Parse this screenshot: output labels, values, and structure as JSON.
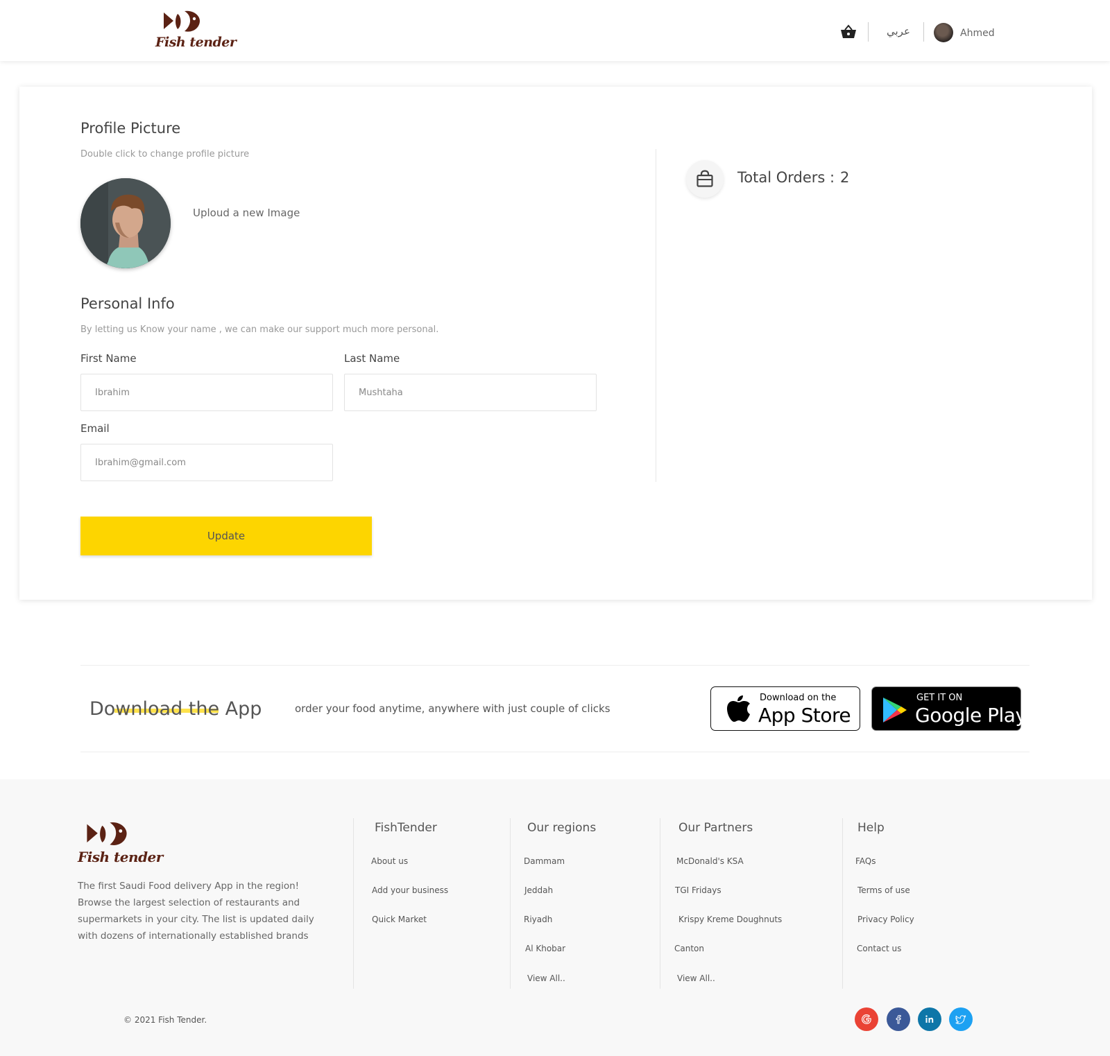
{
  "header": {
    "logo_text": "Fish tender",
    "lang_link": "عربي",
    "user_name": "Ahmed"
  },
  "profile": {
    "title": "Profile Picture",
    "subtitle": "Double click to change profile picture",
    "upload_link": "Uploud a new Image"
  },
  "personal_info": {
    "title": "Personal Info",
    "subtitle": "By letting us Know your name , we can make our support much more personal.",
    "first_name_label": "First Name",
    "first_name_value": "Ibrahim",
    "last_name_label": "Last Name",
    "last_name_value": "Mushtaha",
    "email_label": "Email",
    "email_value": "Ibrahim@gmail.com",
    "update_button": "Update"
  },
  "orders": {
    "label": "Total Orders :",
    "count": "2"
  },
  "download": {
    "title": "Download the App",
    "text": "order your food anytime, anywhere with just couple of clicks",
    "appstore_small": "Download on the",
    "appstore_big": "App Store",
    "gplay_small": "GET IT ON",
    "gplay_big": "Google Play"
  },
  "footer": {
    "logo_text": "Fish tender",
    "description": "The first Saudi Food delivery App in the region! Browse the largest selection of restaurants and supermarkets in your city. The list is updated daily with dozens of internationally established brands",
    "columns": [
      {
        "title": "FishTender",
        "links": [
          "About us",
          "Add your business",
          "Quick Market"
        ]
      },
      {
        "title": "Our regions",
        "links": [
          "Dammam",
          "Jeddah",
          "Riyadh",
          "Al Khobar",
          "View All.."
        ]
      },
      {
        "title": "Our Partners",
        "links": [
          "McDonald's KSA",
          "TGI Fridays",
          "Krispy Kreme Doughnuts",
          "Canton",
          "View All.."
        ]
      },
      {
        "title": "Help",
        "links": [
          "FAQs",
          "Terms of use",
          "Privacy Policy",
          "Contact us"
        ]
      }
    ],
    "copyright": "© 2021 Fish Tender.",
    "social": [
      {
        "name": "google",
        "color": "#ea4335"
      },
      {
        "name": "facebook",
        "color": "#3b5998"
      },
      {
        "name": "linkedin",
        "color": "#0e76a8"
      },
      {
        "name": "twitter",
        "color": "#1da1f2"
      }
    ]
  },
  "colors": {
    "accent": "#fdd500",
    "brand": "#5b2214"
  }
}
